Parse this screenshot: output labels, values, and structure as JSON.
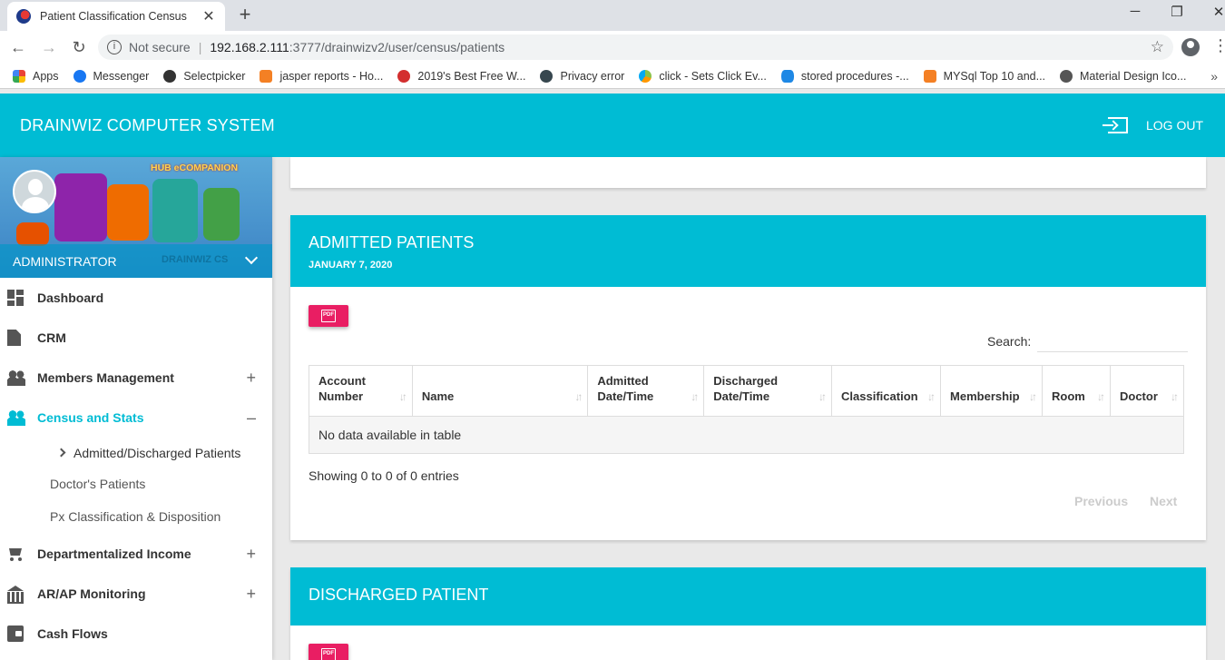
{
  "browser": {
    "tab_title": "Patient Classification Census",
    "close_glyph": "✕",
    "new_tab_glyph": "+",
    "security_label": "Not secure",
    "url_host": "192.168.2.111",
    "url_rest": ":3777/drainwizv2/user/census/patients",
    "bookmarks": [
      {
        "label": "Apps",
        "color": "#4285f4"
      },
      {
        "label": "Messenger",
        "color": "#1877f2"
      },
      {
        "label": "Selectpicker",
        "color": "#333333"
      },
      {
        "label": "jasper reports - Ho...",
        "color": "#f48024"
      },
      {
        "label": "2019's Best Free W...",
        "color": "#d32f2f"
      },
      {
        "label": "Privacy error",
        "color": "#37474f"
      },
      {
        "label": "click - Sets Click Ev...",
        "color": "#8bc34a"
      },
      {
        "label": "stored procedures -...",
        "color": "#1e88e5"
      },
      {
        "label": "MYSql Top 10 and...",
        "color": "#f48024"
      },
      {
        "label": "Material Design Ico...",
        "color": "#555555"
      }
    ]
  },
  "header": {
    "brand": "DRAINWIZ COMPUTER SYSTEM",
    "logout_label": "LOG OUT"
  },
  "sidebar": {
    "banner_text": "HUB eCOMPANION",
    "watermark": "DRAINWIZ CS",
    "user_role": "ADMINISTRATOR",
    "items": [
      {
        "label": "Dashboard",
        "icon": "dashboard-icon",
        "toggle": ""
      },
      {
        "label": "CRM",
        "icon": "document-icon",
        "toggle": ""
      },
      {
        "label": "Members Management",
        "icon": "people-icon",
        "toggle": "+"
      },
      {
        "label": "Census and Stats",
        "icon": "people-icon",
        "toggle": "–"
      },
      {
        "label": "Departmentalized Income",
        "icon": "cart-icon",
        "toggle": "+"
      },
      {
        "label": "AR/AP Monitoring",
        "icon": "bank-icon",
        "toggle": "+"
      },
      {
        "label": "Cash Flows",
        "icon": "wallet-icon",
        "toggle": ""
      }
    ],
    "subitems": [
      {
        "label": "Admitted/Discharged Patients"
      },
      {
        "label": "Doctor's Patients"
      },
      {
        "label": "Px Classification & Disposition"
      }
    ]
  },
  "admitted": {
    "title": "ADMITTED PATIENTS",
    "date": "JANUARY 7, 2020",
    "pdf_label": "PDF",
    "search_label": "Search:",
    "search_value": "",
    "columns": [
      [
        "Account",
        "Number"
      ],
      [
        "",
        "Name"
      ],
      [
        "Admitted",
        "Date/Time"
      ],
      [
        "Discharged",
        "Date/Time"
      ],
      [
        "",
        "Classification"
      ],
      [
        "",
        "Membership"
      ],
      [
        "",
        "Room"
      ],
      [
        "",
        "Doctor"
      ]
    ],
    "sort_glyph": "↓↑",
    "empty_text": "No data available in table",
    "info_text": "Showing 0 to 0 of 0 entries",
    "prev_label": "Previous",
    "next_label": "Next"
  },
  "discharged": {
    "title": "DISCHARGED PATIENT",
    "pdf_label": "PDF"
  }
}
